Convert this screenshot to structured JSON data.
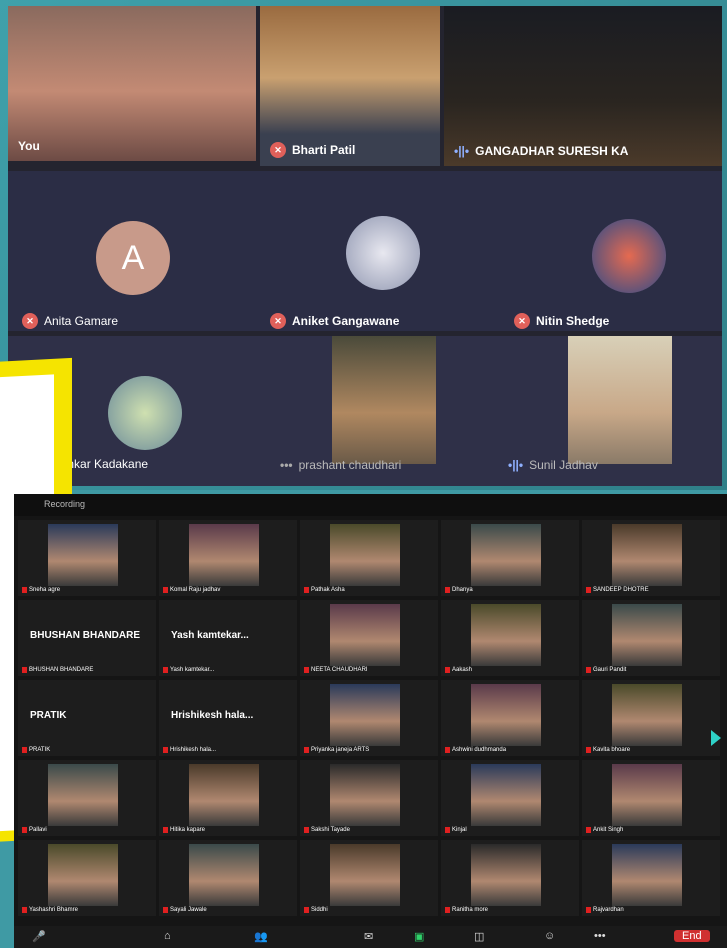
{
  "meet": {
    "tiles": [
      {
        "name": "You"
      },
      {
        "name": "Bharti Patil"
      },
      {
        "name": "GANGADHAR SURESH KA"
      },
      {
        "name": "Anita Gamare",
        "avatar_letter": "A"
      },
      {
        "name": "Aniket Gangawane"
      },
      {
        "name": "Nitin Shedge"
      },
      {
        "name": "dinkar Kadakane"
      },
      {
        "name": "prashant chaudhari"
      },
      {
        "name": "Sunil Jadhav"
      }
    ]
  },
  "zoom": {
    "top_label": "Recording",
    "tiles": [
      "Sneha agre",
      "Komal Raju jadhav",
      "Pathak Asha",
      "Dhanya",
      "SANDEEP DHOTRE",
      "BHUSHAN BHANDARE",
      "Yash kamtekar...",
      "NEETA CHAUDHARI",
      "Aakash",
      "Gauri Pandit",
      "PRATIK",
      "Hrishikesh hala...",
      "Priyanka janeja ARTS",
      "Ashwini dudhmanda",
      "Kavita bhoare",
      "Pallavi",
      "Hitika kapare",
      "Sakshi Tayade",
      "Kinjal",
      "Ankit Singh",
      "Yashashri Bhamre",
      "Sayali Jawale",
      "Siddhi",
      "Ranitha more",
      "Rajvardhan"
    ]
  },
  "colors": {
    "meet_bg": "#24242f",
    "accent": "#e0605a",
    "teal": "#3f9aa4",
    "yellow": "#f5e400"
  }
}
